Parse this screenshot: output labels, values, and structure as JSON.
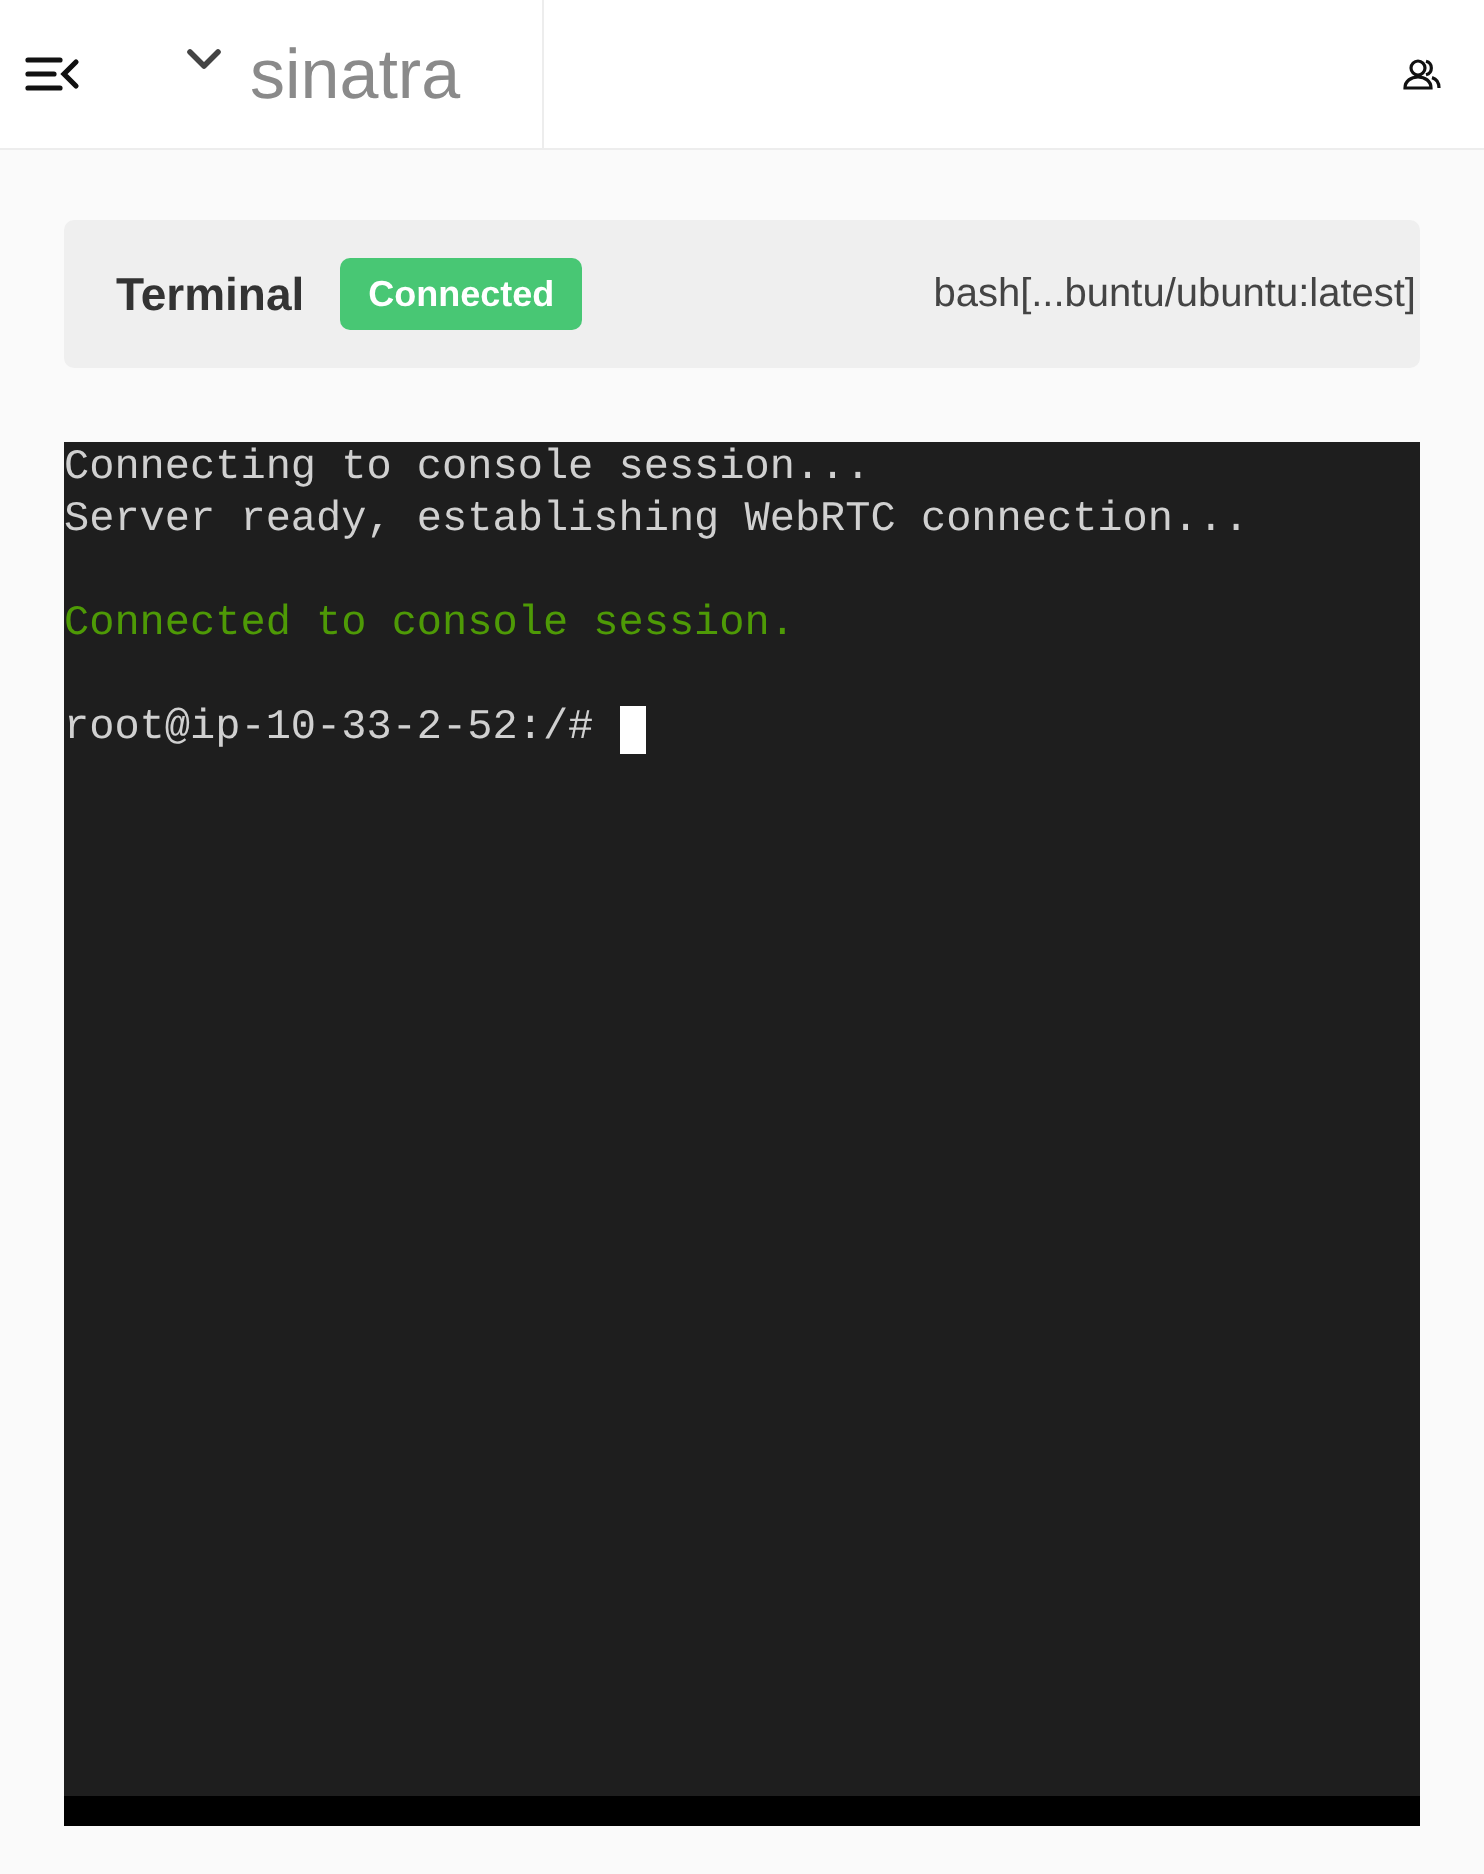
{
  "header": {
    "project": "sinatra"
  },
  "terminal_card": {
    "title": "Terminal",
    "status": {
      "label": "Connected",
      "kind": "success"
    },
    "target": "bash[...buntu/ubuntu:latest]"
  },
  "console": {
    "lines": [
      {
        "kind": "output",
        "text": "Connecting to console session..."
      },
      {
        "kind": "output",
        "text": "Server ready, establishing WebRTC connection..."
      },
      {
        "kind": "blank"
      },
      {
        "kind": "success",
        "text": "Connected to console session."
      },
      {
        "kind": "blank"
      },
      {
        "kind": "prompt",
        "text": "root@ip-10-33-2-52:/#",
        "cursor": true
      }
    ]
  }
}
